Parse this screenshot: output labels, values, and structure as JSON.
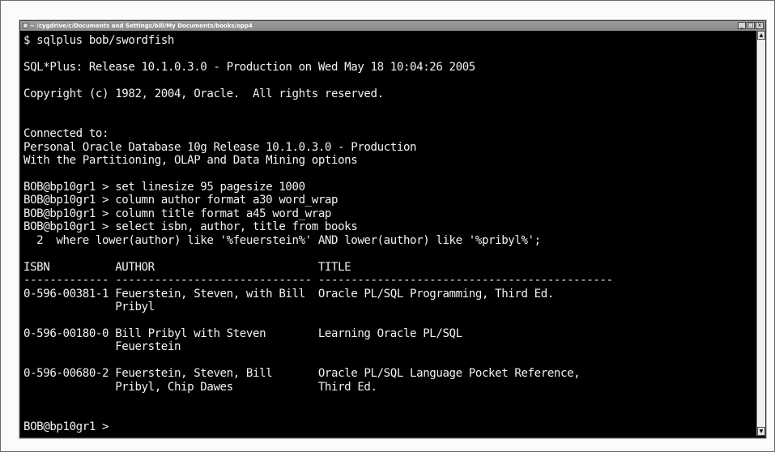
{
  "window": {
    "title": "~ /cygdrive/c/Documents and Settings/bill/My Documents/books/opp4",
    "controls": {
      "minimize": "_",
      "maximize": "□",
      "close": "x"
    }
  },
  "console": {
    "lines": [
      "$ sqlplus bob/swordfish",
      "",
      "SQL*Plus: Release 10.1.0.3.0 - Production on Wed May 18 10:04:26 2005",
      "",
      "Copyright (c) 1982, 2004, Oracle.  All rights reserved.",
      "",
      "",
      "Connected to:",
      "Personal Oracle Database 10g Release 10.1.0.3.0 - Production",
      "With the Partitioning, OLAP and Data Mining options",
      "",
      "BOB@bp10gr1 > set linesize 95 pagesize 1000",
      "BOB@bp10gr1 > column author format a30 word_wrap",
      "BOB@bp10gr1 > column title format a45 word_wrap",
      "BOB@bp10gr1 > select isbn, author, title from books",
      "  2  where lower(author) like '%feuerstein%' AND lower(author) like '%pribyl%';",
      "",
      "ISBN          AUTHOR                         TITLE",
      "------------- ------------------------------ ---------------------------------------------",
      "0-596-00381-1 Feuerstein, Steven, with Bill  Oracle PL/SQL Programming, Third Ed.",
      "              Pribyl",
      "",
      "0-596-00180-0 Bill Pribyl with Steven        Learning Oracle PL/SQL",
      "              Feuerstein",
      "",
      "0-596-00680-2 Feuerstein, Steven, Bill       Oracle PL/SQL Language Pocket Reference,",
      "              Pribyl, Chip Dawes             Third Ed.",
      "",
      "",
      "BOB@bp10gr1 >"
    ]
  },
  "scrollbar": {
    "up": "▲",
    "down": "▼"
  },
  "colors": {
    "background": "#000000",
    "text": "#f2f2f2",
    "titlebar": "#8f8f8f"
  }
}
